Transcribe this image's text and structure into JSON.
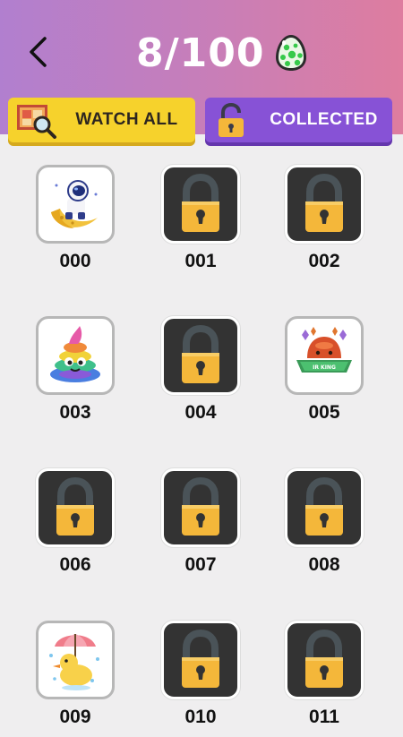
{
  "header": {
    "progress": "8/100",
    "back_icon": "chevron-left-icon",
    "egg_icon": "egg-icon"
  },
  "tabs": [
    {
      "label": "WATCH ALL",
      "icon": "magnifier-picture-icon",
      "color": "#f6d22c"
    },
    {
      "label": "COLLECTED",
      "icon": "lock-icon",
      "color": "#8752d6"
    }
  ],
  "items": [
    {
      "number": "000",
      "locked": false,
      "art": "astronaut-moon"
    },
    {
      "number": "001",
      "locked": true
    },
    {
      "number": "002",
      "locked": true
    },
    {
      "number": "003",
      "locked": false,
      "art": "rainbow-poop"
    },
    {
      "number": "004",
      "locked": true
    },
    {
      "number": "005",
      "locked": false,
      "art": "hot-pot-banner",
      "art_text": "IR KING"
    },
    {
      "number": "006",
      "locked": true
    },
    {
      "number": "007",
      "locked": true
    },
    {
      "number": "008",
      "locked": true
    },
    {
      "number": "009",
      "locked": false,
      "art": "duck-umbrella"
    },
    {
      "number": "010",
      "locked": true
    },
    {
      "number": "011",
      "locked": true
    }
  ],
  "colors": {
    "header_gradient_start": "#b17fcf",
    "header_gradient_end": "#de7d9f",
    "lock_body": "#f4b73a",
    "locked_tile": "#333333"
  }
}
